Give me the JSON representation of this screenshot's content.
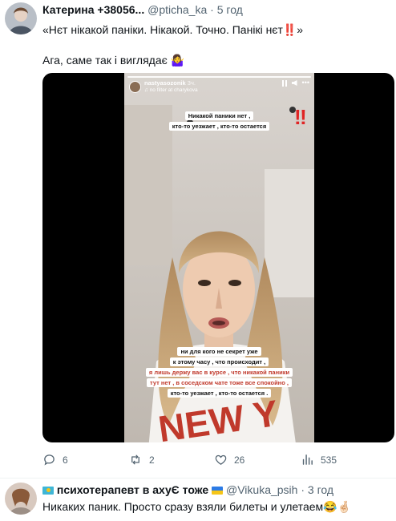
{
  "tweet1": {
    "author_name": "Катерина +38056...",
    "handle": "@pticha_ka",
    "separator": "·",
    "time": "5 год",
    "line1": "«Нєт нікакой паніки. Нікакой. Точно. Панікі нєт",
    "line1_emoji": "‼️",
    "line1_end": "»",
    "line2": "Ага, саме так і виглядає",
    "line2_emoji": "🤷‍♀️",
    "story": {
      "username": "nastyasozonik",
      "time": "3ч.",
      "subline": "♫ no filter at charykova",
      "caption_top": [
        "Никакой паники нет ,",
        "кто-то уезжает , кто-то остается"
      ],
      "exclaim": "‼",
      "caption_bottom": [
        {
          "text": "ни для кого не секрет уже",
          "red": false
        },
        {
          "text": "к этому часу , что происходит ,",
          "red": false
        },
        {
          "text": "я лишь держу вас в курсе , что никакой паники",
          "red": true
        },
        {
          "text": "тут нет , в соседском чате тоже все спокойно ,",
          "red": true
        },
        {
          "text": "кто-то уезжает , кто-то остается .",
          "red": false
        }
      ],
      "shirt_text": "NEW Y"
    },
    "actions": {
      "replies": "6",
      "retweets": "2",
      "likes": "26",
      "views": "535"
    }
  },
  "tweet2": {
    "author_name": "психотерапевт в ахуЄ тоже",
    "handle": "@Vikuka_psih",
    "separator": "·",
    "time": "3 год",
    "text": "Никаких паник. Просто сразу взяли билеты и улетаем",
    "emoji": "😂🤞🏻"
  },
  "colors": {
    "text": "#0f1419",
    "meta": "#536471",
    "red": "#c0392b"
  }
}
